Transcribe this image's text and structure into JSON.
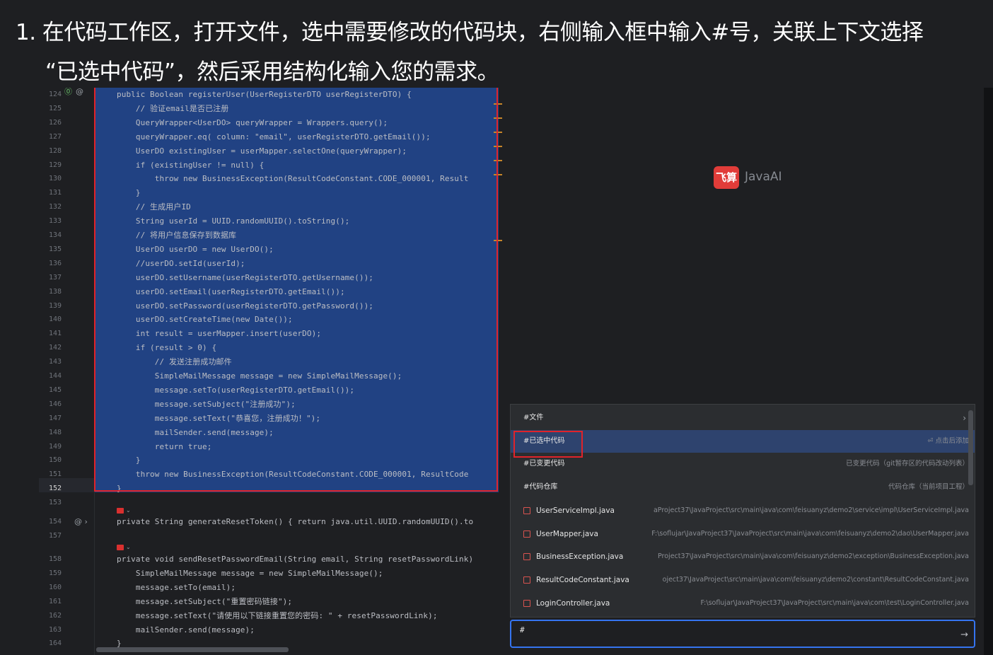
{
  "caption": {
    "line1": "1. 在代码工作区，打开文件，选中需要修改的代码块，右侧输入框中输入#号，关联上下文选择",
    "line2": "“已选中代码”，然后采用结构化输入您的需求。"
  },
  "editor": {
    "lines": [
      {
        "n": "124",
        "code": "public Boolean registerUser(UserRegisterDTO userRegisterDTO) {"
      },
      {
        "n": "125",
        "code": "    // 验证email是否已注册"
      },
      {
        "n": "126",
        "code": "    QueryWrapper<UserDO> queryWrapper = Wrappers.query();"
      },
      {
        "n": "127",
        "code": "    queryWrapper.eq( column: \"email\", userRegisterDTO.getEmail());"
      },
      {
        "n": "128",
        "code": "    UserDO existingUser = userMapper.selectOne(queryWrapper);"
      },
      {
        "n": "129",
        "code": "    if (existingUser != null) {"
      },
      {
        "n": "130",
        "code": "        throw new BusinessException(ResultCodeConstant.CODE_000001, Result"
      },
      {
        "n": "131",
        "code": "    }"
      },
      {
        "n": "132",
        "code": "    // 生成用户ID"
      },
      {
        "n": "133",
        "code": "    String userId = UUID.randomUUID().toString();"
      },
      {
        "n": "134",
        "code": "    // 将用户信息保存到数据库"
      },
      {
        "n": "135",
        "code": "    UserDO userDO = new UserDO();"
      },
      {
        "n": "136",
        "code": "    //userDO.setId(userId);"
      },
      {
        "n": "137",
        "code": "    userDO.setUsername(userRegisterDTO.getUsername());"
      },
      {
        "n": "138",
        "code": "    userDO.setEmail(userRegisterDTO.getEmail());"
      },
      {
        "n": "139",
        "code": "    userDO.setPassword(userRegisterDTO.getPassword());"
      },
      {
        "n": "140",
        "code": "    userDO.setCreateTime(new Date());"
      },
      {
        "n": "141",
        "code": "    int result = userMapper.insert(userDO);"
      },
      {
        "n": "142",
        "code": "    if (result > 0) {"
      },
      {
        "n": "143",
        "code": "        // 发送注册成功邮件"
      },
      {
        "n": "144",
        "code": "        SimpleMailMessage message = new SimpleMailMessage();"
      },
      {
        "n": "145",
        "code": "        message.setTo(userRegisterDTO.getEmail());"
      },
      {
        "n": "146",
        "code": "        message.setSubject(\"注册成功\");"
      },
      {
        "n": "147",
        "code": "        message.setText(\"恭喜您，注册成功！\");"
      },
      {
        "n": "148",
        "code": "        mailSender.send(message);"
      },
      {
        "n": "149",
        "code": "        return true;"
      },
      {
        "n": "150",
        "code": "    }"
      },
      {
        "n": "151",
        "code": "    throw new BusinessException(ResultCodeConstant.CODE_000001, ResultCode"
      },
      {
        "n": "152",
        "code": "}"
      },
      {
        "n": "153",
        "code": ""
      }
    ],
    "lines_b": [
      {
        "n": "154",
        "code": "private String generateResetToken() { return java.util.UUID.randomUUID().to"
      },
      {
        "n": "157",
        "code": ""
      }
    ],
    "lines_c": [
      {
        "n": "158",
        "code": "private void sendResetPasswordEmail(String email, String resetPasswordLink)"
      },
      {
        "n": "159",
        "code": "    SimpleMailMessage message = new SimpleMailMessage();"
      },
      {
        "n": "160",
        "code": "    message.setTo(email);"
      },
      {
        "n": "161",
        "code": "    message.setSubject(\"重置密码链接\");"
      },
      {
        "n": "162",
        "code": "    message.setText(\"请使用以下链接重置您的密码: \" + resetPasswordLink);"
      },
      {
        "n": "163",
        "code": "    mailSender.send(message);"
      },
      {
        "n": "164",
        "code": "}"
      }
    ]
  },
  "assistant": {
    "logo_mark": "飞算",
    "logo_text": "JavaAI",
    "menu": [
      {
        "label": "#文件",
        "desc": "",
        "chevron": "›"
      },
      {
        "label": "#已选中代码",
        "desc": "⏎ 点击后添加"
      },
      {
        "label": "#已变更代码",
        "desc": "已变更代码（git暂存区的代码改动列表）"
      },
      {
        "label": "#代码仓库",
        "desc": "代码仓库（当前项目工程）"
      }
    ],
    "files": [
      {
        "name": "UserServiceImpl.java",
        "path": "aProject37\\JavaProject\\src\\main\\java\\com\\feisuanyz\\demo2\\service\\impl\\UserServiceImpl.java"
      },
      {
        "name": "UserMapper.java",
        "path": "F:\\soflujar\\JavaProject37\\JavaProject\\src\\main\\java\\com\\feisuanyz\\demo2\\dao\\UserMapper.java"
      },
      {
        "name": "BusinessException.java",
        "path": "Project37\\JavaProject\\src\\main\\java\\com\\feisuanyz\\demo2\\exception\\BusinessException.java"
      },
      {
        "name": "ResultCodeConstant.java",
        "path": "oject37\\JavaProject\\src\\main\\java\\com\\feisuanyz\\demo2\\constant\\ResultCodeConstant.java"
      },
      {
        "name": "LoginController.java",
        "path": "F:\\soflujar\\JavaProject37\\JavaProject\\src\\main\\java\\com\\test\\LoginController.java"
      }
    ],
    "input_value": "#",
    "send_icon": "→"
  },
  "colors": {
    "selection": "#214283",
    "highlight_border": "#e0232a",
    "brand": "#e13c39",
    "input_border": "#3574f0"
  }
}
